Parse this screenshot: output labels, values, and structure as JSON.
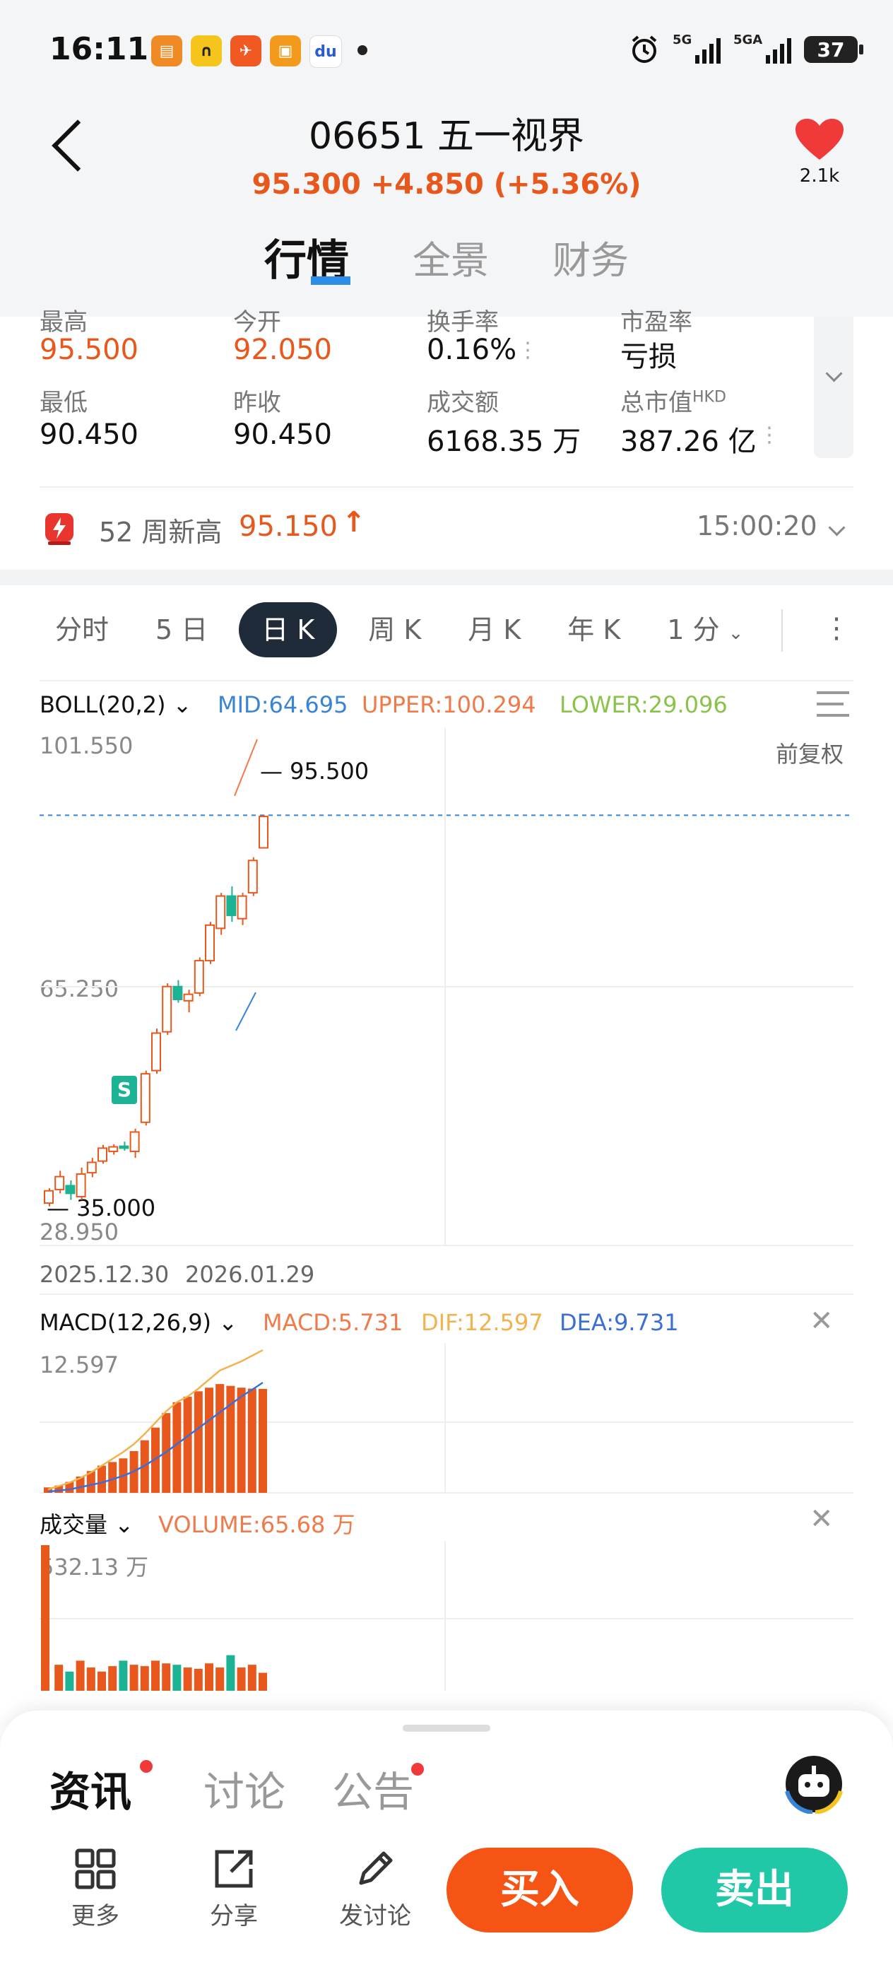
{
  "status_bar": {
    "time": "16:11",
    "network_1": "5G",
    "network_2": "5GA",
    "battery": "37"
  },
  "header": {
    "stock_code": "06651",
    "stock_name": "五一视界",
    "stock_title": "06651 五一视界",
    "price_line": "95.300  +4.850  (+5.36%)",
    "favorite_count": "2.1k",
    "tabs": [
      {
        "label": "行情",
        "active": true
      },
      {
        "label": "全景",
        "active": false
      },
      {
        "label": "财务",
        "active": false
      }
    ]
  },
  "stats": {
    "row1": [
      {
        "label": "最高",
        "value": "95.500",
        "up": true
      },
      {
        "label": "今开",
        "value": "92.050",
        "up": true
      },
      {
        "label": "换手率",
        "value": "0.16%",
        "up": false
      },
      {
        "label": "市盈率",
        "value": "亏损",
        "up": false
      }
    ],
    "row2": [
      {
        "label": "最低",
        "value": "90.450"
      },
      {
        "label": "昨收",
        "value": "90.450"
      },
      {
        "label": "成交额",
        "value": "6168.35 万"
      },
      {
        "label": "总市值",
        "sup": "HKD",
        "value": "387.26 亿"
      }
    ]
  },
  "alert": {
    "label": "52 周新高",
    "value": "95.150",
    "time": "15:00:20"
  },
  "kline_tabs": [
    "分时",
    "5 日",
    "日 K",
    "周 K",
    "月 K",
    "年 K",
    "1 分"
  ],
  "kline_active": "日 K",
  "boll": {
    "name": "BOLL(20,2)",
    "mid": "MID:64.695",
    "upper": "UPPER:100.294",
    "lower": "LOWER:29.096",
    "adjust": "前复权",
    "y_top": "101.550",
    "y_mid": "65.250",
    "y_bottom": "28.950",
    "high_mark": "95.500",
    "low_mark": "35.000",
    "date_start": "2025.12.30",
    "date_end": "2026.01.29",
    "signal": "S"
  },
  "macd": {
    "name": "MACD(12,26,9)",
    "macd": "MACD:5.731",
    "dif": "DIF:12.597",
    "dea": "DEA:9.731",
    "y_top": "12.597"
  },
  "volume": {
    "name": "成交量",
    "value": "VOLUME:65.68 万",
    "y_top": "532.13 万"
  },
  "bottom": {
    "tabs": [
      "资讯",
      "讨论",
      "公告"
    ],
    "tools": [
      "更多",
      "分享",
      "发讨论"
    ],
    "buy": "买入",
    "sell": "卖出"
  },
  "colors": {
    "up": "#e8581c",
    "down": "#1bb394",
    "mid": "#3a84d6",
    "upper": "#f07a4a",
    "lower": "#8bc34a",
    "dif": "#f3b250",
    "dea": "#3a6fd6"
  },
  "chart_data": {
    "type": "candlestick",
    "title": "",
    "x_start": "2025.12.30",
    "x_end": "2026.01.29",
    "candles": [
      {
        "o": 35.5,
        "h": 37.8,
        "l": 35.0,
        "c": 37.4
      },
      {
        "o": 37.6,
        "h": 40.5,
        "l": 37.0,
        "c": 39.6
      },
      {
        "o": 38.2,
        "h": 39.0,
        "l": 36.0,
        "c": 37.0
      },
      {
        "o": 36.5,
        "h": 41.0,
        "l": 36.0,
        "c": 40.0
      },
      {
        "o": 40.2,
        "h": 42.5,
        "l": 39.5,
        "c": 41.8
      },
      {
        "o": 42.0,
        "h": 44.5,
        "l": 41.6,
        "c": 44.0
      },
      {
        "o": 43.5,
        "h": 44.6,
        "l": 43.0,
        "c": 44.2
      },
      {
        "o": 44.3,
        "h": 45.0,
        "l": 43.6,
        "c": 44.0
      },
      {
        "o": 43.5,
        "h": 47.0,
        "l": 42.5,
        "c": 46.5
      },
      {
        "o": 48.0,
        "h": 56.0,
        "l": 47.5,
        "c": 55.5
      },
      {
        "o": 56.0,
        "h": 62.5,
        "l": 55.5,
        "c": 61.8
      },
      {
        "o": 62.0,
        "h": 69.5,
        "l": 61.5,
        "c": 69.0
      },
      {
        "o": 69.0,
        "h": 70.0,
        "l": 66.5,
        "c": 67.0
      },
      {
        "o": 66.8,
        "h": 68.5,
        "l": 65.0,
        "c": 67.8
      },
      {
        "o": 68.0,
        "h": 73.5,
        "l": 67.5,
        "c": 73.0
      },
      {
        "o": 73.0,
        "h": 79.0,
        "l": 72.5,
        "c": 78.5
      },
      {
        "o": 78.0,
        "h": 83.5,
        "l": 77.0,
        "c": 83.0
      },
      {
        "o": 83.0,
        "h": 84.5,
        "l": 79.0,
        "c": 80.0
      },
      {
        "o": 79.5,
        "h": 83.5,
        "l": 78.5,
        "c": 83.0
      },
      {
        "o": 83.5,
        "h": 89.0,
        "l": 83.0,
        "c": 88.5
      },
      {
        "o": 90.45,
        "h": 95.5,
        "l": 90.45,
        "c": 95.3
      }
    ],
    "ylim": [
      28.95,
      101.55
    ],
    "macd_hist": [
      0.3,
      0.4,
      0.6,
      0.9,
      1.2,
      1.5,
      1.7,
      1.9,
      2.3,
      2.9,
      3.6,
      4.4,
      5.0,
      5.3,
      5.6,
      5.8,
      6.0,
      5.9,
      5.8,
      5.75,
      5.731
    ],
    "dif": [
      0.3,
      0.6,
      0.9,
      1.3,
      1.8,
      2.4,
      3.0,
      3.6,
      4.3,
      5.2,
      6.2,
      7.2,
      8.0,
      8.5,
      9.2,
      10.0,
      10.8,
      11.2,
      11.6,
      12.1,
      12.597
    ],
    "dea": [
      0.1,
      0.2,
      0.3,
      0.5,
      0.7,
      0.9,
      1.2,
      1.5,
      1.9,
      2.4,
      3.0,
      3.6,
      4.3,
      5.0,
      5.7,
      6.4,
      7.1,
      7.8,
      8.5,
      9.1,
      9.731
    ],
    "volume": [
      532.13,
      95,
      70,
      110,
      85,
      70,
      90,
      110,
      95,
      90,
      110,
      100,
      95,
      85,
      80,
      100,
      85,
      130,
      85,
      95,
      65.68
    ]
  }
}
